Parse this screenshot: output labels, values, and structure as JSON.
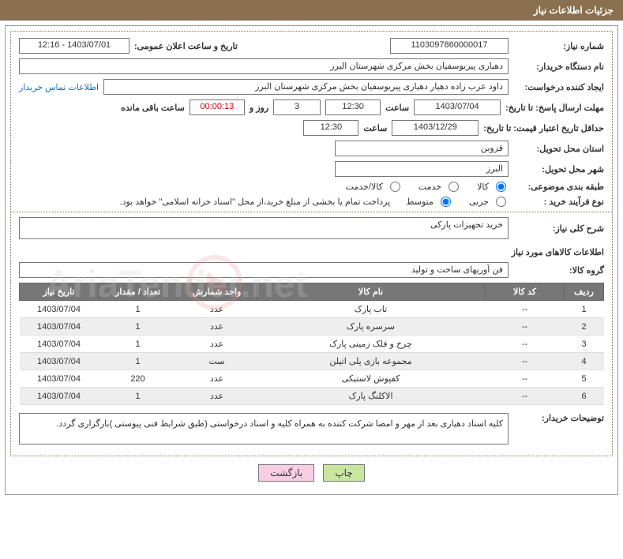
{
  "header_title": "جزئیات اطلاعات نیاز",
  "fields": {
    "need_no_label": "شماره نیاز:",
    "need_no": "1103097860000017",
    "announce_label": "تاریخ و ساعت اعلان عمومی:",
    "announce_val": "1403/07/01 - 12:16",
    "buyer_org_label": "نام دستگاه خریدار:",
    "buyer_org": "دهیاری پیریوسفیان بخش مرکزی شهرستان البرز",
    "requester_label": "ایجاد کننده درخواست:",
    "requester": "داود عرب زاده دهیار دهیاری پیریوسفیان بخش مرکزی شهرستان البرز",
    "contact_link": "اطلاعات تماس خریدار",
    "deadline_label": "مهلت ارسال پاسخ: تا تاریخ:",
    "deadline_date": "1403/07/04",
    "time_word": "ساعت",
    "deadline_time": "12:30",
    "days": "3",
    "days_word": "روز و",
    "countdown": "00:00:13",
    "remain_word": "ساعت باقی مانده",
    "validity_label": "حداقل تاریخ اعتبار قیمت: تا تاریخ:",
    "validity_date": "1403/12/29",
    "validity_time": "12:30",
    "province_label": "استان محل تحویل:",
    "province": "قزوین",
    "city_label": "شهر محل تحویل:",
    "city": "البرز",
    "cat_label": "طبقه بندی موضوعی:",
    "cat_opts": {
      "goods": "کالا",
      "service": "خدمت",
      "both": "کالا/خدمت"
    },
    "proc_label": "نوع فرآیند خرید :",
    "proc_opts": {
      "partial": "جزیی",
      "medium": "متوسط"
    },
    "proc_note": "پرداخت تمام یا بخشی از مبلغ خرید،از محل \"اسناد خزانه اسلامی\" خواهد بود.",
    "summary_label": "شرح کلی نیاز:",
    "summary": "خرید تجهیزات پارکی",
    "goods_section": "اطلاعات کالاهای مورد نیاز",
    "group_label": "گروه کالا:",
    "group": "فن آوریهای ساخت و تولید",
    "buyer_notes_label": "توضیحات خریدار:",
    "buyer_notes": "کلیه اسناد دهیاری بعد از مهر و امضا شرکت کننده به همراه کلیه و اسناد درخواستی (طبق شرایط فنی پیوستی )بارگزاری گردد."
  },
  "table": {
    "headers": {
      "row": "ردیف",
      "code": "کد کالا",
      "name": "نام کالا",
      "unit": "واحد شمارش",
      "qty": "تعداد / مقدار",
      "date": "تاریخ نیاز"
    },
    "rows": [
      {
        "row": "1",
        "code": "--",
        "name": "تاب پارک",
        "unit": "عدد",
        "qty": "1",
        "date": "1403/07/04"
      },
      {
        "row": "2",
        "code": "--",
        "name": "سرسره پارک",
        "unit": "عدد",
        "qty": "1",
        "date": "1403/07/04"
      },
      {
        "row": "3",
        "code": "--",
        "name": "چرخ و فلک زمینی پارک",
        "unit": "عدد",
        "qty": "1",
        "date": "1403/07/04"
      },
      {
        "row": "4",
        "code": "--",
        "name": "مجموعه بازی پلی اتیلن",
        "unit": "ست",
        "qty": "1",
        "date": "1403/07/04"
      },
      {
        "row": "5",
        "code": "--",
        "name": "کفپوش لاستیکی",
        "unit": "عدد",
        "qty": "220",
        "date": "1403/07/04"
      },
      {
        "row": "6",
        "code": "--",
        "name": "الاکلنگ پارک",
        "unit": "عدد",
        "qty": "1",
        "date": "1403/07/04"
      }
    ]
  },
  "buttons": {
    "print": "چاپ",
    "back": "بازگشت"
  },
  "watermark": "AriaTender.net"
}
